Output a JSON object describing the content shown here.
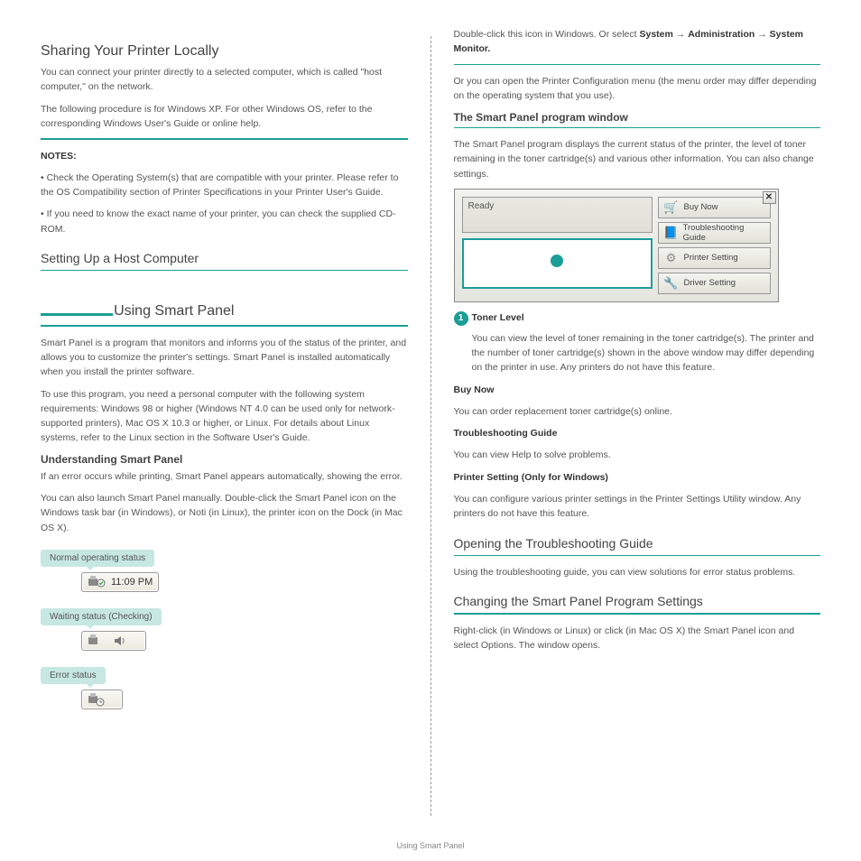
{
  "left": {
    "sharing_h": "Sharing Your Printer Locally",
    "sharing_p1_a": "You can connect your printer directly to a selected computer, which is called \"host computer,\" on the network.",
    "sharing_p1_b": "The following procedure is for Windows XP. For other Windows OS, refer to the corresponding Windows User's Guide or online help.",
    "notes_h": "NOTES:",
    "note1": "• Check the Operating System(s) that are compatible with your printer. Please refer to the OS Compatibility section of Printer Specifications in your Printer User's Guide.",
    "note2": "• If you need to know the exact name of your printer, you can check the supplied CD-ROM.",
    "host_h": "Setting Up a Host Computer",
    "smartpanel_h": "Using Smart Panel",
    "smartpanel_p1": "Smart Panel is a program that monitors and informs you of the status of the printer, and allows you to customize the printer's settings. Smart Panel is installed automatically when you install the printer software.",
    "smartpanel_p2": "To use this program, you need a personal computer with the following system requirements: Windows 98 or higher (Windows NT 4.0 can be used only for network-supported printers), Mac OS X 10.3 or higher, or Linux. For details about Linux systems, refer to the Linux section in the Software User's Guide.",
    "understanding_h": "Understanding Smart Panel",
    "understanding_p": "If an error occurs while printing, Smart Panel appears automatically, showing the error.",
    "launch_p": "You can also launch Smart Panel manually. Double-click the Smart Panel icon on the Windows task bar (in Windows), or Noti (in Linux), the printer icon on the Dock (in Mac OS X).",
    "status_normal": "Normal operating status",
    "status_waiting": "Waiting status (Checking)",
    "status_error": "Error status",
    "tray_time": "11:09 PM"
  },
  "right": {
    "open_path_a": "Double-click this icon in Windows. Or select ",
    "open_path_b": "System",
    "open_path_c": " → ",
    "open_path_d": "Administration",
    "open_path_e": " → ",
    "open_path_f": "System Monitor.",
    "open_path_g": "",
    "open_printer_p": "Or you can open the Printer Configuration menu (the menu order may differ depending on the operating system that you use).",
    "progwin_h": "The Smart Panel program window",
    "progwin_p": "The Smart Panel program displays the current status of the printer, the level of toner remaining in the toner cartridge(s) and various other information. You can also change settings.",
    "dialog": {
      "status": "Ready",
      "btn1": "Buy Now",
      "btn2": "Troubleshooting Guide",
      "btn3": "Printer Setting",
      "btn4": "Driver Setting"
    },
    "callout_num": "1",
    "callout_label": "Toner Level",
    "callout_txt": "You can view the level of toner remaining in the toner cartridge(s). The printer and the number of toner cartridge(s) shown in the above window may differ depending on the printer in use. Any printers do not have this feature.",
    "buynow_h": "Buy Now",
    "buynow_p": "You can order replacement toner cartridge(s) online.",
    "trouble_h": "Troubleshooting Guide",
    "trouble_p": "You can view Help to solve problems.",
    "ps_h": "Printer Setting (Only for Windows)",
    "ps_p": "You can configure various printer settings in the Printer Settings Utility window. Any printers do not have this feature.",
    "opening_h": "Opening the Troubleshooting Guide",
    "opening_p": "Using the troubleshooting guide, you can view solutions for error status problems.",
    "changing_h": "Changing the Smart Panel Program Settings",
    "changing_p": "Right-click (in Windows or Linux) or click (in Mac OS X) the Smart Panel icon and select Options. The window opens."
  },
  "footer": "Using Smart Panel"
}
